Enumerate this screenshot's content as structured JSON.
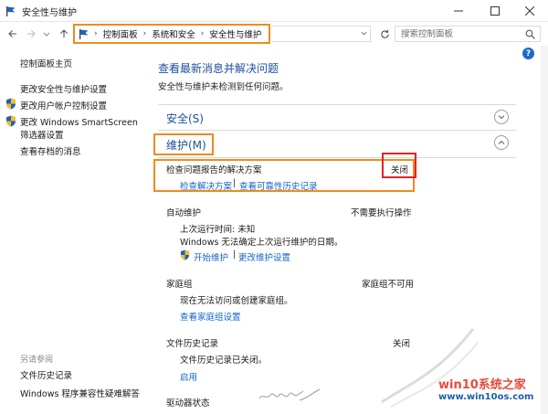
{
  "window": {
    "title": "安全性与维护"
  },
  "nav": {
    "breadcrumbs": [
      "控制面板",
      "系统和安全",
      "安全性与维护"
    ],
    "search_placeholder": "搜索控制面板"
  },
  "sidebar": {
    "items": [
      {
        "label": "控制面板主页",
        "shield": false
      },
      {
        "label": "更改安全性与维护设置",
        "shield": false
      },
      {
        "label": "更改用户帐户控制设置",
        "shield": true
      },
      {
        "label": "更改 Windows SmartScreen",
        "shield": true
      },
      {
        "label": "筛选器设置",
        "shield": false
      },
      {
        "label": "查看存档的消息",
        "shield": false
      }
    ],
    "see_also_title": "另请参阅",
    "see_also": [
      {
        "label": "文件历史记录"
      },
      {
        "label": "Windows 程序兼容性疑难解答"
      }
    ]
  },
  "main": {
    "title": "查看最新消息并解决问题",
    "subtitle": "安全性与维护未检测到任何问题。",
    "security": {
      "label": "安全(S)"
    },
    "maintenance": {
      "label": "维护(M)",
      "problem_reports": {
        "label": "检查问题报告的解决方案",
        "status": "关闭",
        "links": [
          "检查解决方案",
          "查看可靠性历史记录"
        ]
      },
      "auto_maintenance": {
        "label": "自动维护",
        "status": "不需要执行操作",
        "last_run": "上次运行时间: 未知",
        "note": "Windows 无法确定上次运行维护的日期。",
        "links": [
          "开始维护",
          "更改维护设置"
        ]
      },
      "homegroup": {
        "label": "家庭组",
        "status": "家庭组不可用",
        "note": "现在无法访问或创建家庭组。",
        "link": "查看家庭组设置"
      },
      "file_history": {
        "label": "文件历史记录",
        "status": "关闭",
        "note": "文件历史记录已关闭。",
        "link": "启用"
      },
      "drive_status": {
        "label": "驱动器状态"
      }
    }
  },
  "watermark": {
    "brand": "win10系统之家",
    "url": "www.win10os.com"
  },
  "colors": {
    "highlight_orange": "#f08b1d",
    "highlight_red": "#e02424",
    "link_blue": "#1462c8",
    "heading_blue": "#1c4f9c"
  }
}
